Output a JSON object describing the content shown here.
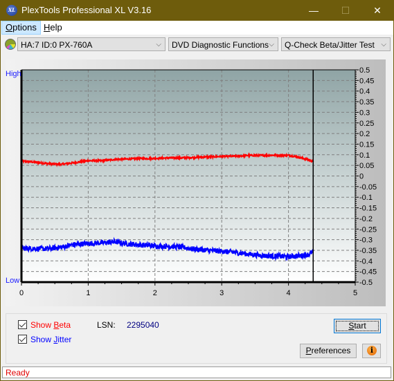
{
  "window": {
    "title": "PlexTools Professional XL V3.16",
    "logo_text": "XL",
    "controls": {
      "minimize": "—",
      "maximize": "☐",
      "close": "✕"
    }
  },
  "menu": [
    {
      "label": "Options",
      "accel": "O",
      "rest": "ptions"
    },
    {
      "label": "Help",
      "accel": "H",
      "rest": "elp"
    }
  ],
  "toolbar": {
    "drive": "HA:7 ID:0  PX-760A",
    "function_group": "DVD Diagnostic Functions",
    "test": "Q-Check Beta/Jitter Test",
    "chevron": "⌵"
  },
  "chart_data": {
    "type": "line",
    "title": "",
    "xlabel": "",
    "ylabel": "",
    "left_axis_labels": {
      "top": "High",
      "bottom": "Low"
    },
    "xlim": [
      0,
      5
    ],
    "ylim": [
      -0.5,
      0.5
    ],
    "x_ticks": [
      0,
      1,
      2,
      3,
      4,
      5
    ],
    "y_ticks": [
      0.5,
      0.45,
      0.4,
      0.35,
      0.3,
      0.25,
      0.2,
      0.15,
      0.1,
      0.05,
      0,
      -0.05,
      -0.1,
      -0.15,
      -0.2,
      -0.25,
      -0.3,
      -0.35,
      -0.4,
      -0.45,
      -0.5
    ],
    "y_tick_labels": [
      "0.5",
      "0.45",
      "0.4",
      "0.35",
      "0.3",
      "0.25",
      "0.2",
      "0.15",
      "0.1",
      "0.05",
      "0",
      "-0.05",
      "-0.1",
      "-0.15",
      "-0.2",
      "-0.25",
      "-0.3",
      "-0.35",
      "-0.4",
      "-0.45",
      "-0.5"
    ],
    "grid": true,
    "end_marker_x": 4.37,
    "series": [
      {
        "name": "Beta",
        "color": "#ff0000",
        "x": [
          0,
          0.2,
          0.4,
          0.6,
          0.8,
          1.0,
          1.2,
          1.4,
          1.6,
          1.8,
          2.0,
          2.2,
          2.4,
          2.6,
          2.8,
          3.0,
          3.2,
          3.4,
          3.6,
          3.8,
          4.0,
          4.1,
          4.2,
          4.3,
          4.37
        ],
        "values": [
          0.07,
          0.065,
          0.058,
          0.055,
          0.063,
          0.072,
          0.072,
          0.078,
          0.08,
          0.082,
          0.083,
          0.085,
          0.085,
          0.088,
          0.09,
          0.092,
          0.093,
          0.097,
          0.097,
          0.098,
          0.097,
          0.092,
          0.085,
          0.076,
          0.068
        ],
        "noise": 0.004
      },
      {
        "name": "Jitter",
        "color": "#0000ff",
        "x": [
          0,
          0.2,
          0.4,
          0.6,
          0.8,
          1.0,
          1.2,
          1.4,
          1.6,
          1.8,
          2.0,
          2.2,
          2.4,
          2.6,
          2.8,
          3.0,
          3.2,
          3.4,
          3.6,
          3.8,
          4.0,
          4.2,
          4.3,
          4.37
        ],
        "values": [
          -0.34,
          -0.342,
          -0.343,
          -0.335,
          -0.322,
          -0.318,
          -0.315,
          -0.31,
          -0.32,
          -0.325,
          -0.33,
          -0.332,
          -0.335,
          -0.345,
          -0.35,
          -0.355,
          -0.36,
          -0.368,
          -0.375,
          -0.378,
          -0.38,
          -0.375,
          -0.37,
          -0.355
        ],
        "noise": 0.012
      }
    ]
  },
  "controls": {
    "show_beta": {
      "label_pre": "Show ",
      "accel": "B",
      "label_post": "eta",
      "checked": true,
      "color": "#ff0000"
    },
    "show_jitter": {
      "label_pre": "Show ",
      "accel": "J",
      "label_post": "itter",
      "checked": true,
      "color": "#0000ff"
    },
    "lsn_label": "LSN:",
    "lsn_value": "2295040",
    "start": {
      "accel": "S",
      "rest": "tart"
    },
    "preferences": {
      "accel": "P",
      "rest": "references"
    },
    "info_icon": "i"
  },
  "status": "Ready"
}
